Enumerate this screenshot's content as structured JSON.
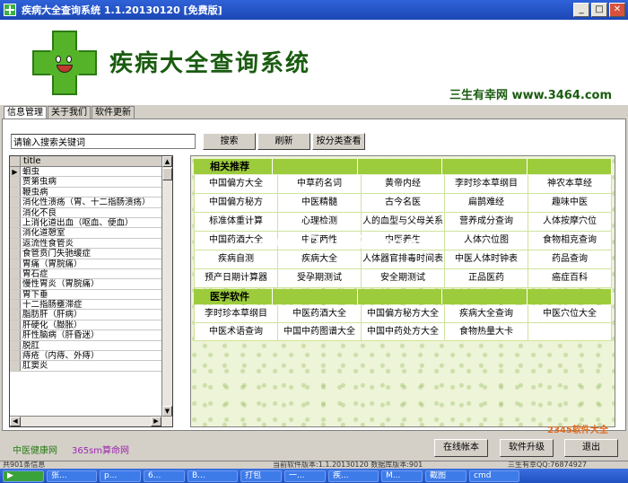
{
  "window": {
    "title": "疾病大全查询系统 1.1.20130120 [免费版]",
    "close_label": "✕",
    "min_label": "_",
    "max_label": "□"
  },
  "header": {
    "app_title": "疾病大全查询系统",
    "site_tag": "三生有幸网 www.3464.com",
    "brand_color": "#55b32a"
  },
  "tabs": [
    {
      "label": "信息管理",
      "active": true
    },
    {
      "label": "关于我们",
      "active": false
    },
    {
      "label": "软件更新",
      "active": false
    }
  ],
  "search": {
    "value": "请输入搜索关键词",
    "search_label": "搜索",
    "refresh_label": "刷新",
    "category_label": "按分类查看"
  },
  "disease_list": {
    "column": "title",
    "current_marker": "▶",
    "items": [
      "蛔虫",
      "贾第虫病",
      "鞭虫病",
      "消化性溃疡（胃、十二指肠溃疡）",
      "消化不良",
      "上消化道出血（呕血、便血）",
      "消化道憩室",
      "返流性食管炎",
      "食管贲门失驰缓症",
      "胃痛（胃脘痛）",
      "胃石症",
      "慢性胃炎（胃脘痛）",
      "胃下垂",
      "十二指肠壅滞症",
      "脂肪肝（肝病）",
      "肝硬化（臌胀）",
      "肝性脑病（肝昏迷）",
      "脱肛",
      "痔疮（内痔、外痔）",
      "肛窦炎"
    ]
  },
  "recommend": {
    "heading": "相关推荐",
    "rows": [
      [
        "中国偏方大全",
        "中草药名词",
        "黄帝内经",
        "李时珍本草纲目",
        "神农本草经"
      ],
      [
        "中国偏方秘方",
        "中医精髓",
        "古今名医",
        "扁鹊难经",
        "趣味中医"
      ],
      [
        "标准体重计算",
        "心理检测",
        "人的血型与父母关系",
        "营养成分查询",
        "人体按摩穴位"
      ],
      [
        "中国药酒大全",
        "中医两性",
        "中医养生",
        "人体穴位图",
        "食物相克查询"
      ],
      [
        "疾病自测",
        "疾病大全",
        "人体器官排毒时间表",
        "中医人体时钟表",
        "药品查询"
      ],
      [
        "预产日期计算器",
        "受孕期测试",
        "安全期测试",
        "正品医药",
        "癌症百科"
      ]
    ]
  },
  "software": {
    "heading": "医学软件",
    "rows": [
      [
        "李时珍本草纲目",
        "中医药酒大全",
        "中国偏方秘方大全",
        "疾病大全查询",
        "中医穴位大全"
      ],
      [
        "中医术语查询",
        "中国中药图谱大全",
        "中国中药处方大全",
        "食物热量大卡",
        ""
      ]
    ]
  },
  "bottom": {
    "link1": "中医健康网",
    "link2": "365sm算命网",
    "online_label": "在线帐本",
    "upgrade_label": "软件升级",
    "exit_label": "退出"
  },
  "status": {
    "left": "共901条信息",
    "middle": "当前软件版本:1.1.20130120  数据库版本:901",
    "right": "三生有幸QQ:76874927"
  },
  "taskbar": [
    "张...",
    "p...",
    "6...",
    "B...",
    "打包",
    "一...",
    "疾...",
    "M...",
    "截图",
    "cmd"
  ],
  "watermarks": {
    "center": "www.DuoTe.com",
    "corner": "2345软件大全"
  }
}
